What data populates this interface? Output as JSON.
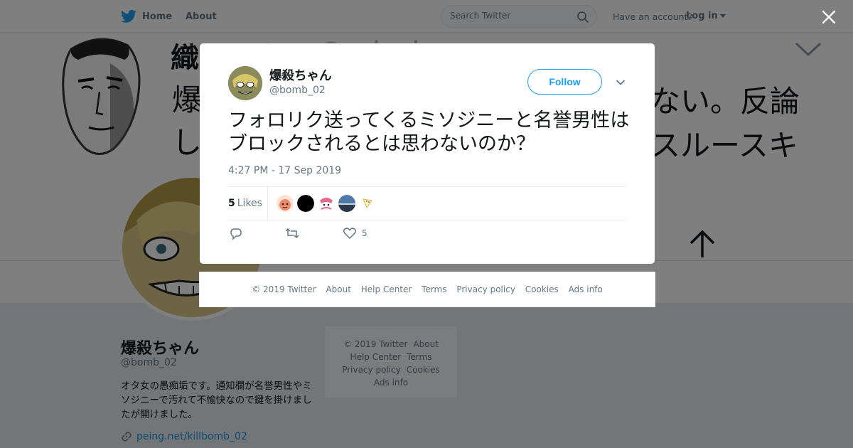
{
  "topbar": {
    "home": "Home",
    "about": "About",
    "search_placeholder": "Search Twitter",
    "have_account": "Have an account?",
    "login": "Log in"
  },
  "banner": {
    "name_fragment": "織田三郎",
    "handle_fragment": "@oda_bo",
    "line1": "爆",
    "line1_right": "ない。反論",
    "line2": "し",
    "line2_right": "スルースキ"
  },
  "profile": {
    "name": "爆殺ちゃん",
    "handle": "@bomb_02",
    "bio": "オタ女の愚痴垢です。通知欄が名誉男性やミソジニーで汚れて不愉快なので鍵を掛けましたが開けました。",
    "link": "peing.net/killbomb_02"
  },
  "side_footer": {
    "row1": [
      "© 2019 Twitter",
      "About"
    ],
    "row2": [
      "Help Center",
      "Terms"
    ],
    "row3": [
      "Privacy policy",
      "Cookies"
    ],
    "row4": [
      "Ads info"
    ]
  },
  "tweet": {
    "name": "爆殺ちゃん",
    "handle": "@bomb_02",
    "follow_label": "Follow",
    "text": "フォロリク送ってくるミソジニーと名誉男性はブロックされるとは思わないのか？",
    "timestamp": "4:27 PM - 17 Sep 2019",
    "likes_count": "5",
    "likes_label": "Likes",
    "like_action_count": "5"
  },
  "modal_footer": [
    "© 2019 Twitter",
    "About",
    "Help Center",
    "Terms",
    "Privacy policy",
    "Cookies",
    "Ads info"
  ],
  "colors": {
    "accent": "#1da1f2",
    "link": "#1b95e0",
    "muted": "#657786"
  }
}
